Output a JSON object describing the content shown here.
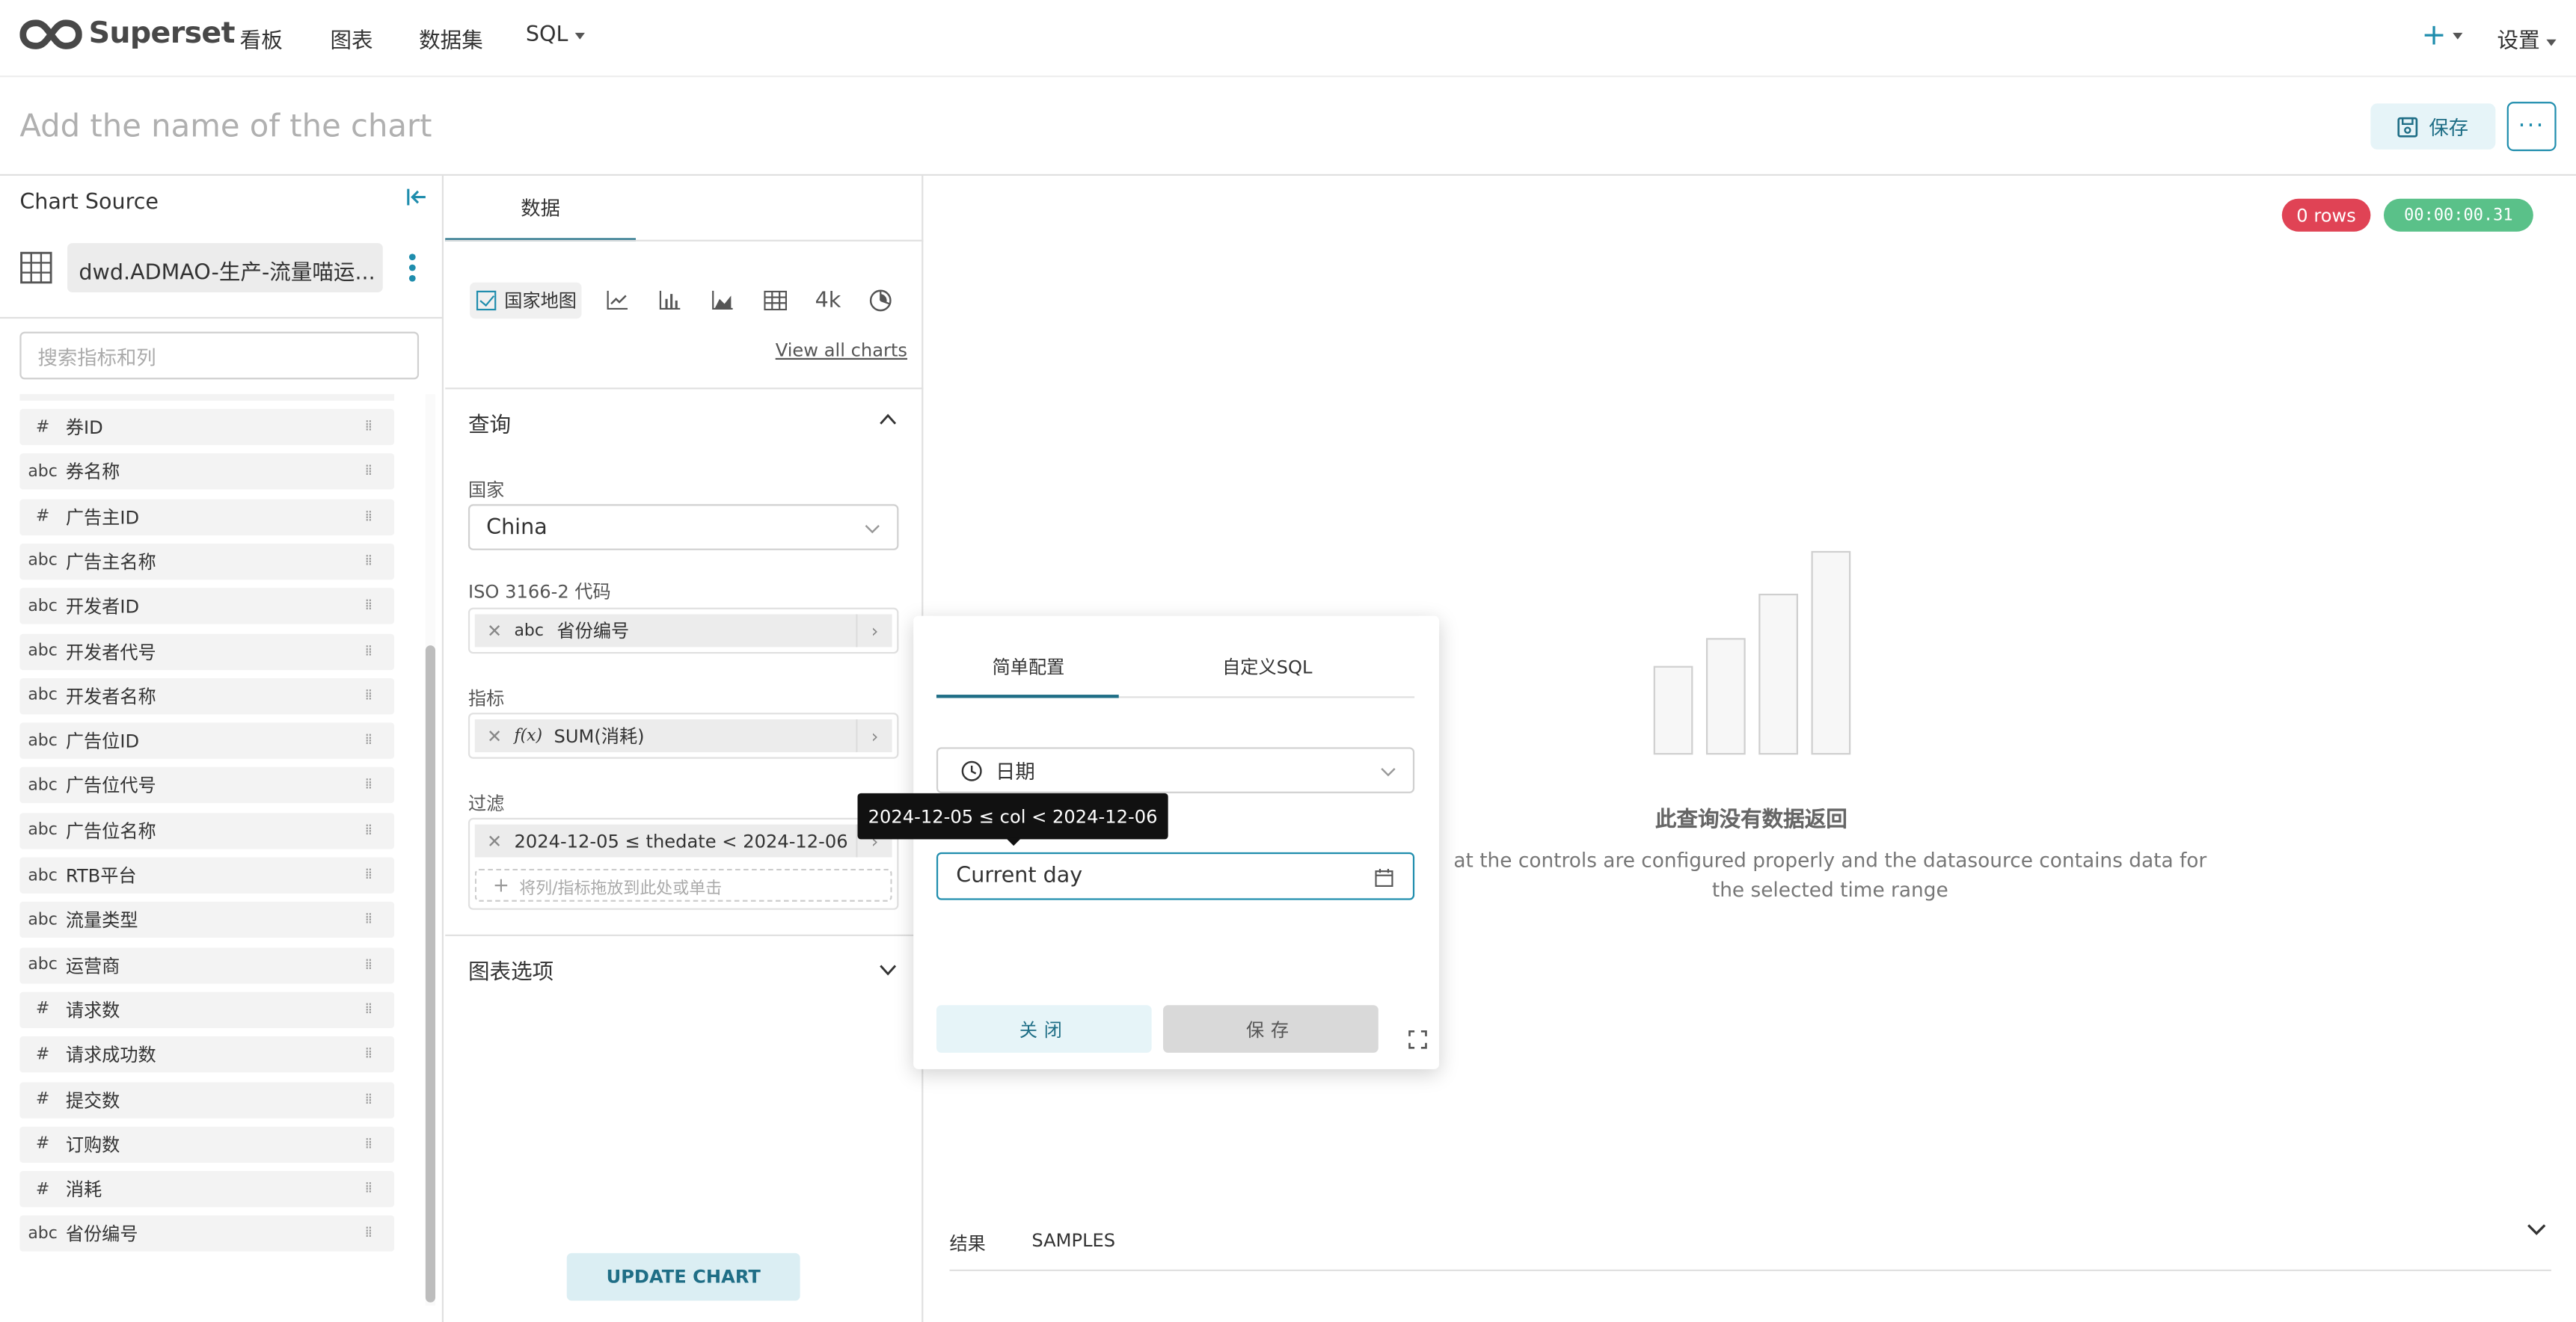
{
  "nav": {
    "brand": "Superset",
    "items": [
      {
        "label": "看板"
      },
      {
        "label": "图表"
      },
      {
        "label": "数据集"
      },
      {
        "label": "SQL"
      }
    ],
    "plus": "+",
    "settings": "设置"
  },
  "header": {
    "chart_title_placeholder": "Add the name of the chart",
    "save_label": "保存",
    "more_label": "···"
  },
  "chart_source": {
    "title": "Chart Source",
    "dataset_name": "dwd.ADMAO-生产-流量喵运...",
    "search_placeholder": "搜索指标和列",
    "columns": [
      {
        "type": "#",
        "name": "券ID"
      },
      {
        "type": "abc",
        "name": "券名称"
      },
      {
        "type": "#",
        "name": "广告主ID"
      },
      {
        "type": "abc",
        "name": "广告主名称"
      },
      {
        "type": "abc",
        "name": "开发者ID"
      },
      {
        "type": "abc",
        "name": "开发者代号"
      },
      {
        "type": "abc",
        "name": "开发者名称"
      },
      {
        "type": "abc",
        "name": "广告位ID"
      },
      {
        "type": "abc",
        "name": "广告位代号"
      },
      {
        "type": "abc",
        "name": "广告位名称"
      },
      {
        "type": "abc",
        "name": "RTB平台"
      },
      {
        "type": "abc",
        "name": "流量类型"
      },
      {
        "type": "abc",
        "name": "运营商"
      },
      {
        "type": "#",
        "name": "请求数"
      },
      {
        "type": "#",
        "name": "请求成功数"
      },
      {
        "type": "#",
        "name": "提交数"
      },
      {
        "type": "#",
        "name": "订购数"
      },
      {
        "type": "#",
        "name": "消耗"
      },
      {
        "type": "abc",
        "name": "省份编号"
      }
    ]
  },
  "control_panel": {
    "tab_data": "数据",
    "viz_selected": "国家地图",
    "viz_bignum": "4k",
    "view_all": "View all charts",
    "query_title": "查询",
    "country_label": "国家",
    "country_value": "China",
    "iso_label": "ISO 3166-2 代码",
    "iso_type": "abc",
    "iso_value": "省份编号",
    "metric_label": "指标",
    "metric_type": "f(x)",
    "metric_value": "SUM(消耗)",
    "filter_label": "过滤",
    "filter_value": "2024-12-05 ≤ thedate < 2024-12-06",
    "drop_hint": "将列/指标拖放到此处或单击",
    "chart_options_title": "图表选项",
    "update_button": "UPDATE CHART"
  },
  "results": {
    "rows_badge": "0 rows",
    "time_badge": "00:00:00.31",
    "empty_title": "此查询没有数据返回",
    "empty_desc_1": "at the controls are configured properly and the datasource contains data for",
    "empty_desc_2": "the selected time range",
    "tab_results": "结果",
    "tab_samples": "SAMPLES"
  },
  "popover": {
    "tab_simple": "简单配置",
    "tab_custom": "自定义SQL",
    "column_value": "日期",
    "range_value": "Current day",
    "tooltip": "2024-12-05 ≤ col < 2024-12-06",
    "close_label": "关闭",
    "save_label": "保存"
  },
  "colors": {
    "accent": "#1f8dad",
    "accent_dark": "#1f6e86",
    "error": "#e04355",
    "success": "#5ac189"
  }
}
